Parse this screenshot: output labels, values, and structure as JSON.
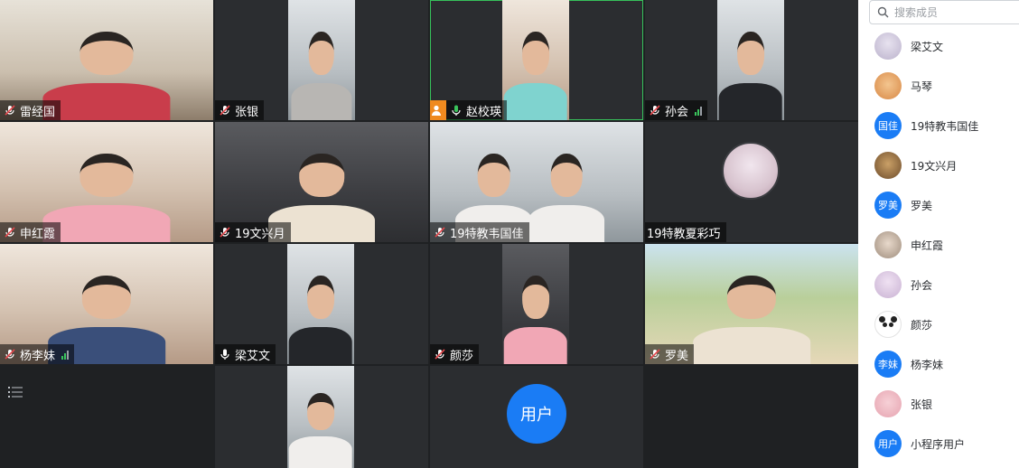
{
  "tiles": [
    {
      "name": "雷经国"
    },
    {
      "name": "张银"
    },
    {
      "name": "赵校瑛"
    },
    {
      "name": "孙会"
    },
    {
      "name": "申红霞"
    },
    {
      "name": "19文兴月"
    },
    {
      "name": "19特教韦国佳"
    },
    {
      "name": "19特教夏彩巧"
    },
    {
      "name": "杨李妹"
    },
    {
      "name": "梁艾文"
    },
    {
      "name": "颜莎"
    },
    {
      "name": "罗美"
    },
    {
      "name": "",
      "icon": "list-icon"
    },
    {
      "name": ""
    },
    {
      "name": "",
      "avatar_text": "用户"
    },
    {
      "name": ""
    }
  ],
  "colors": {
    "speaking_border": "#37c15b",
    "host_badge": "#ef8a1f",
    "avatar_blue": "#1a7cf5",
    "grid_bg": "#1f2123"
  },
  "sidebar": {
    "search_placeholder": "搜索成员",
    "members": [
      {
        "name": "梁艾文",
        "avatar": "photo"
      },
      {
        "name": "马琴",
        "avatar": "photo"
      },
      {
        "name": "19特教韦国佳",
        "avatar_text": "国佳"
      },
      {
        "name": "19文兴月",
        "avatar": "photo"
      },
      {
        "name": "罗美",
        "avatar_text": "罗美"
      },
      {
        "name": "申红霞",
        "avatar": "photo"
      },
      {
        "name": "孙会",
        "avatar": "photo"
      },
      {
        "name": "颜莎",
        "avatar": "panda"
      },
      {
        "name": "杨李妹",
        "avatar_text": "李妹"
      },
      {
        "name": "张银",
        "avatar": "photo"
      },
      {
        "name": "小程序用户",
        "avatar_text": "用户"
      }
    ]
  }
}
